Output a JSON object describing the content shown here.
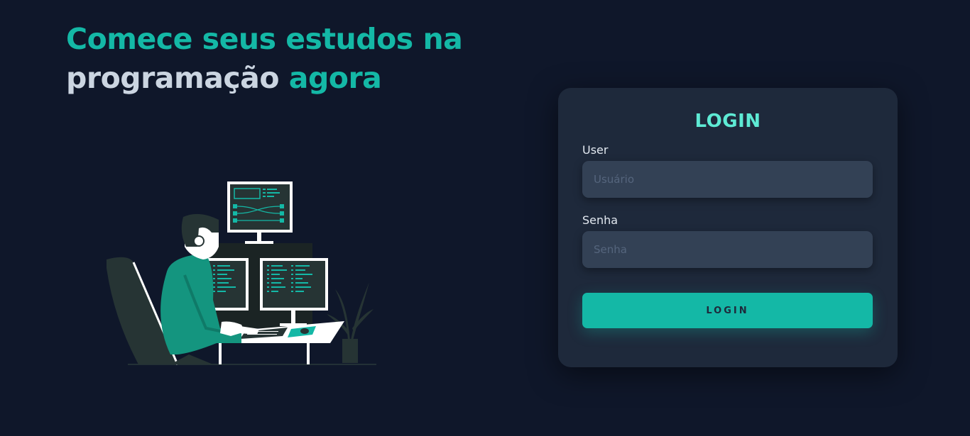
{
  "hero": {
    "line1": "Comece seus estudos na",
    "line2_part1": "programação",
    "line2_part2": "agora"
  },
  "login": {
    "title": "LOGIN",
    "user_label": "User",
    "user_placeholder": "Usuário",
    "password_label": "Senha",
    "password_placeholder": "Senha",
    "button_label": "LOGIN"
  },
  "colors": {
    "background": "#0f172a",
    "card": "#1e293b",
    "input": "#334155",
    "accent": "#14b8a6",
    "title_accent": "#5eead4"
  },
  "icons": [
    "programmer-illustration"
  ]
}
